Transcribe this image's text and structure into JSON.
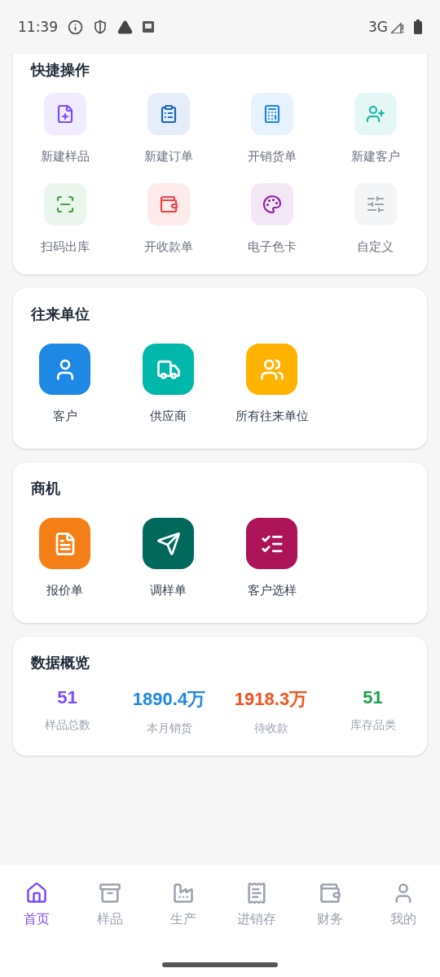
{
  "status_bar": {
    "time": "11:39",
    "network": "3G"
  },
  "quick_actions": {
    "title": "快捷操作",
    "items": [
      {
        "label": "新建样品",
        "kind": "file-plus",
        "color": "#7c4dff"
      },
      {
        "label": "新建订单",
        "kind": "clipboard",
        "color": "#1565c0"
      },
      {
        "label": "开销货单",
        "kind": "register",
        "color": "#1e88e5"
      },
      {
        "label": "新建客户",
        "kind": "user-plus",
        "color": "#14b8a6"
      },
      {
        "label": "扫码出库",
        "kind": "scan",
        "color": "#43a047"
      },
      {
        "label": "开收款单",
        "kind": "wallet",
        "color": "#ef4444"
      },
      {
        "label": "电子色卡",
        "kind": "palette",
        "color": "#8e24aa"
      },
      {
        "label": "自定义",
        "kind": "sliders",
        "color": "#9ca3af"
      }
    ]
  },
  "partners": {
    "title": "往来单位",
    "items": [
      {
        "label": "客户",
        "kind": "user",
        "color": "#1e88e5"
      },
      {
        "label": "供应商",
        "kind": "truck",
        "color": "#00b8a9"
      },
      {
        "label": "所有往来单位",
        "kind": "users",
        "color": "#ffb300"
      }
    ]
  },
  "opportunities": {
    "title": "商机",
    "items": [
      {
        "label": "报价单",
        "kind": "receipt",
        "color": "#f57f17"
      },
      {
        "label": "调样单",
        "kind": "send",
        "color": "#00695c"
      },
      {
        "label": "客户选样",
        "kind": "checklist",
        "color": "#ad1457"
      }
    ]
  },
  "overview": {
    "title": "数据概览",
    "stats": [
      {
        "value": "51",
        "label": "样品总数",
        "color": "#7c4dff"
      },
      {
        "value": "1890.4万",
        "label": "本月销货",
        "color": "#1e88e5"
      },
      {
        "value": "1918.3万",
        "label": "待收款",
        "color": "#f4511e"
      },
      {
        "value": "51",
        "label": "库存品类",
        "color": "#16a34a"
      }
    ]
  },
  "bottom_nav": [
    {
      "label": "首页",
      "kind": "home",
      "selected": true
    },
    {
      "label": "样品",
      "kind": "archive",
      "selected": false
    },
    {
      "label": "生产",
      "kind": "factory",
      "selected": false
    },
    {
      "label": "进销存",
      "kind": "receipt",
      "selected": false
    },
    {
      "label": "财务",
      "kind": "wallet",
      "selected": false
    },
    {
      "label": "我的",
      "kind": "user",
      "selected": false
    }
  ]
}
